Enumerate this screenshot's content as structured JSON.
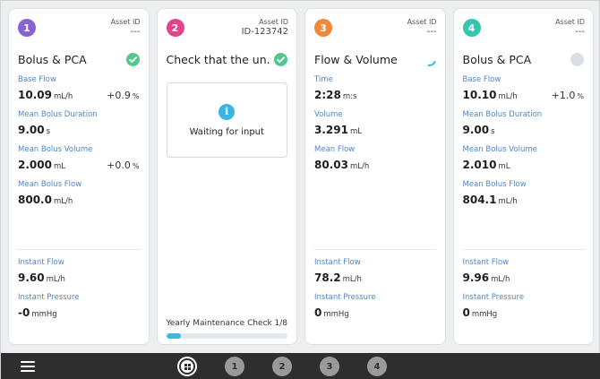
{
  "colors": {
    "badge1": "#8a63d2",
    "badge2": "#e0448a",
    "badge3": "#f0893a",
    "badge4": "#35c5b0",
    "accent": "#3fb8dd",
    "ok": "#52c88f"
  },
  "cards": [
    {
      "number": "1",
      "asset_label": "Asset ID",
      "asset_value": "---",
      "title": "Bolus & PCA",
      "status": "check-circle-icon",
      "metrics": [
        {
          "label": "Base Flow",
          "value": "10.09",
          "unit": "mL/h",
          "delta": "+0.9",
          "delta_unit": "%"
        },
        {
          "label": "Mean Bolus Duration",
          "value": "9.00",
          "unit": "s"
        },
        {
          "label": "Mean Bolus Volume",
          "value": "2.000",
          "unit": "mL",
          "delta": "+0.0",
          "delta_unit": "%"
        },
        {
          "label": "Mean Bolus Flow",
          "value": "800.0",
          "unit": "mL/h"
        }
      ],
      "bottom": [
        {
          "label": "Instant Flow",
          "value": "9.60",
          "unit": "mL/h"
        },
        {
          "label": "Instant Pressure",
          "value": "-0",
          "unit": "mmHg"
        }
      ]
    },
    {
      "number": "2",
      "asset_label": "Asset ID",
      "asset_value": "ID-123742",
      "title": "Check that the un...",
      "status": "check-circle-icon",
      "waiting_text": "Waiting for input",
      "info_glyph": "i",
      "maintenance_label": "Yearly Maintenance Check",
      "maintenance_count": "1/8",
      "maintenance_progress": 0.125
    },
    {
      "number": "3",
      "asset_label": "Asset ID",
      "asset_value": "---",
      "title": "Flow & Volume",
      "status": "loading-spinner-icon",
      "metrics": [
        {
          "label": "Time",
          "value": "2:28",
          "unit": "m:s"
        },
        {
          "label": "Volume",
          "value": "3.291",
          "unit": "mL"
        },
        {
          "label": "Mean Flow",
          "value": "80.03",
          "unit": "mL/h"
        }
      ],
      "bottom": [
        {
          "label": "Instant Flow",
          "value": "78.2",
          "unit": "mL/h"
        },
        {
          "label": "Instant Pressure",
          "value": "0",
          "unit": "mmHg"
        }
      ]
    },
    {
      "number": "4",
      "asset_label": "Asset ID",
      "asset_value": "---",
      "title": "Bolus & PCA",
      "status": "idle-status-icon",
      "metrics": [
        {
          "label": "Base Flow",
          "value": "10.10",
          "unit": "mL/h",
          "delta": "+1.0",
          "delta_unit": "%"
        },
        {
          "label": "Mean Bolus Duration",
          "value": "9.00",
          "unit": "s"
        },
        {
          "label": "Mean Bolus Volume",
          "value": "2.010",
          "unit": "mL"
        },
        {
          "label": "Mean Bolus Flow",
          "value": "804.1",
          "unit": "mL/h"
        }
      ],
      "bottom": [
        {
          "label": "Instant Flow",
          "value": "9.96",
          "unit": "mL/h"
        },
        {
          "label": "Instant Pressure",
          "value": "0",
          "unit": "mmHg"
        }
      ]
    }
  ],
  "taskbar": {
    "menu_icon": "hamburger-menu-icon",
    "overview_icon": "grid-overview-icon",
    "tabs": [
      "1",
      "2",
      "3",
      "4"
    ]
  }
}
